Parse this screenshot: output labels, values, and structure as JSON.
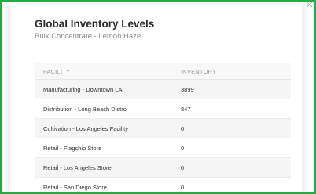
{
  "modal": {
    "title": "Global Inventory Levels",
    "subtitle": "Bulk Concentrate - Lemon Haze",
    "close_icon": "×"
  },
  "table": {
    "headers": [
      "FACILITY",
      "INVENTORY"
    ],
    "rows": [
      {
        "facility": "Manufacturing - Downtown LA",
        "inventory": "3899"
      },
      {
        "facility": "Distribution - Long Beach Distro",
        "inventory": "847"
      },
      {
        "facility": "Cultivation - Los Angeles Facility",
        "inventory": "0"
      },
      {
        "facility": "Retail - Flagship Store",
        "inventory": "0"
      },
      {
        "facility": "Retail - Los Angeles Store",
        "inventory": "0"
      },
      {
        "facility": "Retail - San Diego Store",
        "inventory": "0"
      }
    ]
  },
  "colors": {
    "frame_border": "#1fae3f",
    "title_text": "#2c2c2c",
    "subtitle_text": "#8a8a8a",
    "header_text": "#a0a0a0"
  }
}
